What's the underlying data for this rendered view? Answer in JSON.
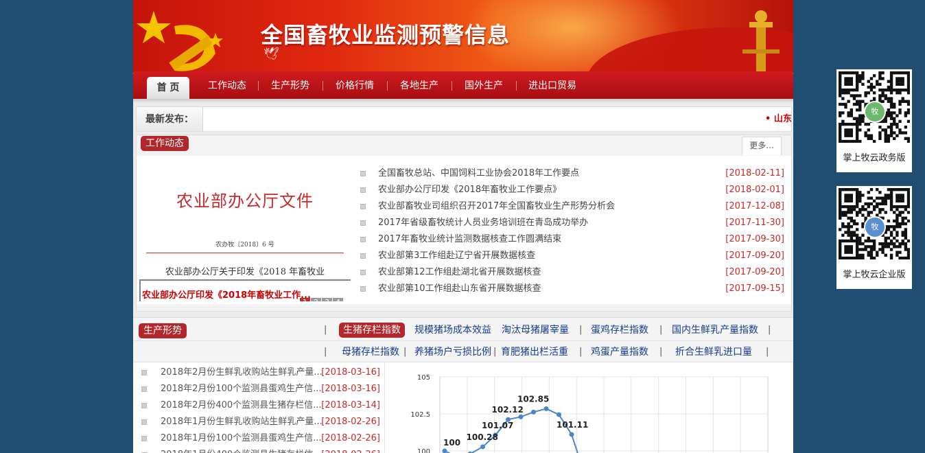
{
  "banner": {
    "title": "全国畜牧业监测预警信息"
  },
  "nav": {
    "items": [
      "首 页",
      "工作动态",
      "生产形势",
      "价格行情",
      "各地生产",
      "国外生产",
      "进出口贸易"
    ]
  },
  "latest": {
    "label": "最新发布：",
    "marquee": "• 山东"
  },
  "work": {
    "tag": "工作动态",
    "more": "更多...",
    "slide": {
      "heading": "农业部办公厅文件",
      "doc_no": "农办牧〔2018〕6 号",
      "subtitle": "农业部办公厅关于印发《2018 年畜牧业",
      "caption": "农业部办公厅印发《2018年畜牧业工作...",
      "pages": [
        "1",
        "2",
        "3",
        "4",
        "5"
      ]
    },
    "news": [
      {
        "title": "全国畜牧总站、中国饲料工业协会2018年工作要点",
        "date": "[2018-02-11]"
      },
      {
        "title": "农业部办公厅印发《2018年畜牧业工作要点》",
        "date": "[2018-02-01]"
      },
      {
        "title": "农业部畜牧业司组织召开2017年全国畜牧业生产形势分析会",
        "date": "[2017-12-08]"
      },
      {
        "title": "2017年省级畜牧统计人员业务培训班在青岛成功举办",
        "date": "[2017-11-30]"
      },
      {
        "title": "2017年畜牧业统计监测数据核查工作圆满结束",
        "date": "[2017-09-30]"
      },
      {
        "title": "农业部第3工作组赴辽宁省开展数据核查",
        "date": "[2017-09-20]"
      },
      {
        "title": "农业部第12工作组赴湖北省开展数据核查",
        "date": "[2017-09-20]"
      },
      {
        "title": "农业部第10工作组赴山东省开展数据核查",
        "date": "[2017-09-15]"
      }
    ]
  },
  "production": {
    "tag": "生产形势",
    "tabs_row1": [
      "生猪存栏指数",
      "规模猪场成本效益",
      "淘汰母猪屠宰量",
      "蛋鸡存栏指数",
      "国内生鲜乳产量指数"
    ],
    "tabs_row2": [
      "母猪存栏指数",
      "养猪场户亏损比例",
      "育肥猪出栏活重",
      "鸡蛋产量指数",
      "折合生鲜乳进口量"
    ],
    "pipe": "|",
    "list": [
      {
        "title": "2018年2月份生鲜乳收购站生鲜乳产量...",
        "date": "[2018-03-16]"
      },
      {
        "title": "2018年2月份100个监测县蛋鸡生产信...",
        "date": "[2018-03-16]"
      },
      {
        "title": "2018年2月份400个监测县生猪存栏信...",
        "date": "[2018-03-14]"
      },
      {
        "title": "2018年1月份生鲜乳收购站生鲜乳产量...",
        "date": "[2018-02-26]"
      },
      {
        "title": "2018年1月份100个监测县蛋鸡生产信...",
        "date": "[2018-02-26]"
      },
      {
        "title": "2018年1月份400个监测县生猪存栏信...",
        "date": "[2018-02-26]"
      }
    ]
  },
  "chart_data": {
    "type": "line",
    "ylim": [
      100,
      105
    ],
    "yticks": [
      "105",
      "102.5",
      "100"
    ],
    "series": [
      {
        "values": [
          100,
          99.6,
          99.8,
          100.28,
          101.07,
          102.12,
          102.3,
          102.62,
          102.85,
          102.45,
          101.11,
          98.5
        ]
      }
    ],
    "data_labels": [
      "100",
      "100.28",
      "101.07",
      "102.12",
      "102.85",
      "101.11"
    ],
    "color": "#4a86c8"
  },
  "sidebar": {
    "qr": [
      {
        "caption": "掌上牧云政务版",
        "badge": "牧"
      },
      {
        "caption": "掌上牧云企业版",
        "badge": "牧"
      }
    ]
  }
}
